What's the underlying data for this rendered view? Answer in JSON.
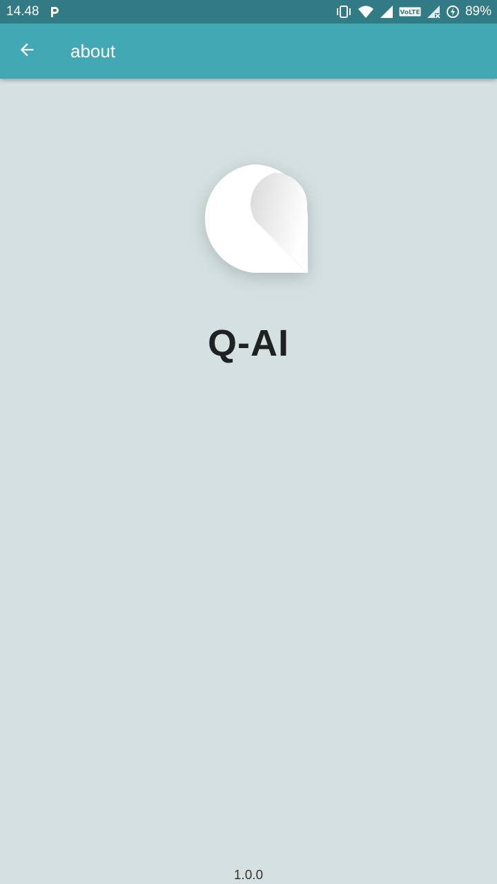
{
  "status_bar": {
    "time": "14.48",
    "notification_icon": "parking-p-icon",
    "icons": [
      "vibrate-icon",
      "wifi-icon",
      "signal-icon",
      "volte-icon",
      "signal-no-sim-icon",
      "data-saver-icon"
    ],
    "volte_label": "VoLTE",
    "battery": "89%"
  },
  "app_bar": {
    "back_icon": "arrow-left-icon",
    "title": "about"
  },
  "main": {
    "logo": "q-ai-logo",
    "app_name": "Q-AI",
    "version": "1.0.0"
  },
  "colors": {
    "status_bar": "#317c84",
    "app_bar": "#42a8b3",
    "background": "#d5e1e1",
    "title_text": "#1e2222"
  }
}
